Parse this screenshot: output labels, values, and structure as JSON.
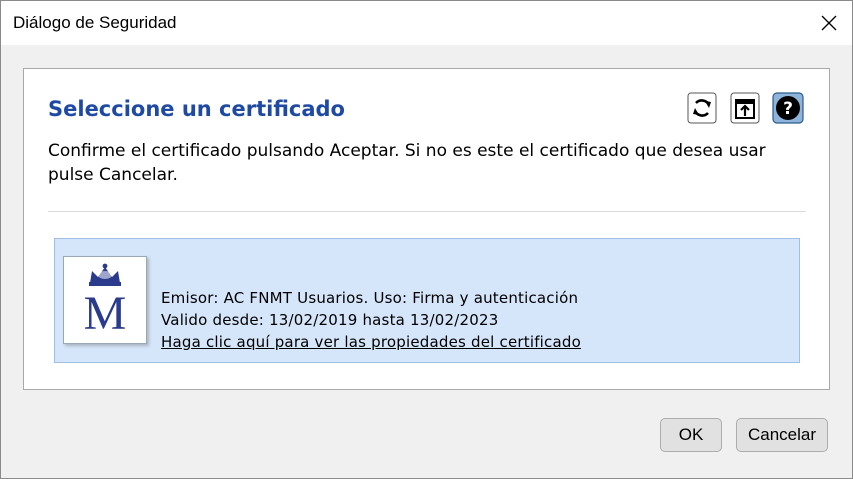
{
  "window": {
    "title": "Diálogo de Seguridad"
  },
  "panel": {
    "heading": "Seleccione un certificado",
    "description": "Confirme el certificado pulsando Aceptar. Si no es este el certificado que desea usar pulse Cancelar.",
    "toolbar": [
      "refresh-icon",
      "import-icon",
      "help-icon"
    ]
  },
  "certificate": {
    "issuer_line": "Emisor: AC FNMT Usuarios. Uso: Firma y autenticación",
    "validity_line": "Valido desde: 13/02/2019 hasta 13/02/2023",
    "properties_link": "Haga clic aquí para ver las propiedades del certificado",
    "logo_letter": "M"
  },
  "buttons": {
    "ok": "OK",
    "cancel": "Cancelar"
  },
  "colors": {
    "heading": "#1f4aa3",
    "cert_background": "#d6e6fa",
    "logo_blue": "#2a3a8c"
  }
}
